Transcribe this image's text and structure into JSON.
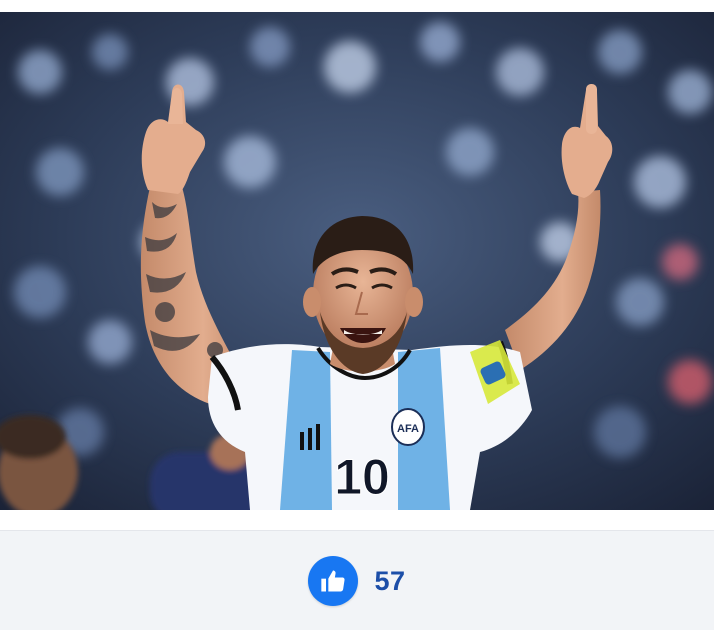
{
  "post": {
    "image": {
      "subject": "player-celebration-photo",
      "jersey_number": "10",
      "badge_text": "AFA"
    },
    "reactions": {
      "icon": "thumbs-up-icon",
      "count": "57",
      "accent_color": "#1877f2",
      "count_color": "#1c4ea8"
    }
  }
}
